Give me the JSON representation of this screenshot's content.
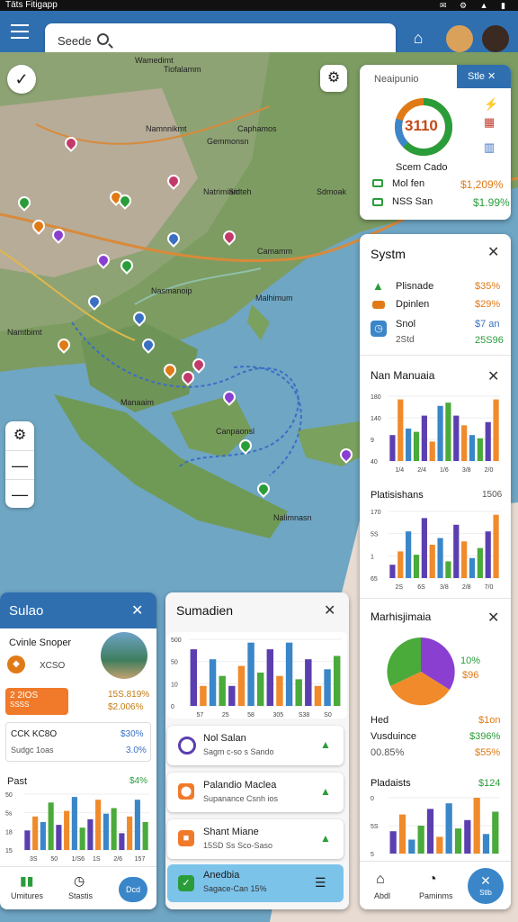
{
  "status": {
    "time": "Täts Fitigapp",
    "icons": "✉ ⚙ ▲ ▮"
  },
  "search": {
    "text": "Seede"
  },
  "map": {
    "labels": [
      "Wamedimt",
      "Namnnikmt",
      "Caphamos",
      "Natrimiam",
      "Sdmoak",
      "Camamm",
      "Nasmanoip",
      "Malhimum",
      "Namtbimt",
      "Manaaim",
      "Canpaonsl",
      "Nalimnasn",
      "Tiofalamm",
      "Gemmonsn",
      "Sidteh"
    ]
  },
  "nav_panel": {
    "title": "Neaipunio",
    "tab": "Stle",
    "donut_value": "3110",
    "donut_caption": "Scem Cado",
    "rows": [
      {
        "label": "Mol fen",
        "value": "$1,209%"
      },
      {
        "label": "NSS San",
        "value": "$1.99%"
      }
    ]
  },
  "systm": {
    "title": "Systm",
    "rows": [
      {
        "label": "Plisnade",
        "value": "$35%"
      },
      {
        "label": "Dpinlen",
        "value": "$29%"
      },
      {
        "label": "Snol",
        "value": "$7 an",
        "sub": "2Std",
        "sub_value": "25S96"
      }
    ]
  },
  "man": {
    "title": "Nan Manuaia",
    "yticks": [
      "180",
      "140",
      "9",
      "40"
    ],
    "xticks": [
      "1/4",
      "2/4",
      "1/6",
      "3/8",
      "2/0"
    ]
  },
  "plat": {
    "title": "Platisishans",
    "right": "1506",
    "yticks": [
      "170",
      "5S",
      "1",
      "65"
    ],
    "xticks": [
      "2S",
      "6S",
      "3/8",
      "2/8",
      "7/0"
    ]
  },
  "marh": {
    "title": "Marhisjimaia",
    "pie_labels": [
      "10%",
      "$96"
    ],
    "rows": [
      {
        "label": "Hed",
        "value": "$1on"
      },
      {
        "label": "Vusduince",
        "value": "$396%"
      },
      {
        "label": "00.85%",
        "value": "$55%"
      }
    ]
  },
  "plad": {
    "title": "Pladaists",
    "right": "$124",
    "yticks": [
      "0",
      "5S",
      "5"
    ]
  },
  "right_nav": {
    "items": [
      {
        "label": "Abdl"
      },
      {
        "label": "Paminms"
      },
      {
        "label": "Stlb"
      }
    ]
  },
  "left_panel": {
    "title": "Sulao",
    "card_title": "Cvinle Snoper",
    "card_sub": "XCSO",
    "orange_left": "2 2IOS",
    "orange_l2": "SSSS",
    "orange_right": "15S.819%",
    "orange_r2": "$2.006%",
    "box_left": "CCK KC8O",
    "box_left2": "Sudgc 1oas",
    "box_right": "$30%",
    "box_right2": "3.0%",
    "chart_title": "Past",
    "chart_right": "$4%",
    "yticks": [
      "50",
      "5s",
      "18",
      "15"
    ],
    "xticks": [
      "3S",
      "50",
      "1/S6",
      "1S",
      "2/6",
      "157"
    ],
    "nav": [
      {
        "label": "Umitures"
      },
      {
        "label": "Stastis"
      },
      {
        "label": "Dcd"
      }
    ]
  },
  "middle_panel": {
    "title": "Sumadien",
    "yticks": [
      "500",
      "50",
      "10",
      "0"
    ],
    "xticks": [
      "57",
      "25",
      "58",
      "305",
      "S38",
      "S0"
    ],
    "items": [
      {
        "title": "Nol Salan",
        "sub": "Sagm c-so s Sando"
      },
      {
        "title": "Palandio Maclea",
        "sub": "Supanance Csnh ios"
      },
      {
        "title": "Shant Miane",
        "sub": "15SD Ss Sco-Saso"
      },
      {
        "title": "Anedbia",
        "sub": "Sagace-Can 15%"
      }
    ]
  },
  "colors": {
    "brand": "#2f6fb0",
    "green": "#2a9d3a",
    "orange": "#e07a16",
    "purple": "#5b3fb0",
    "blue": "#3a86c8"
  }
}
